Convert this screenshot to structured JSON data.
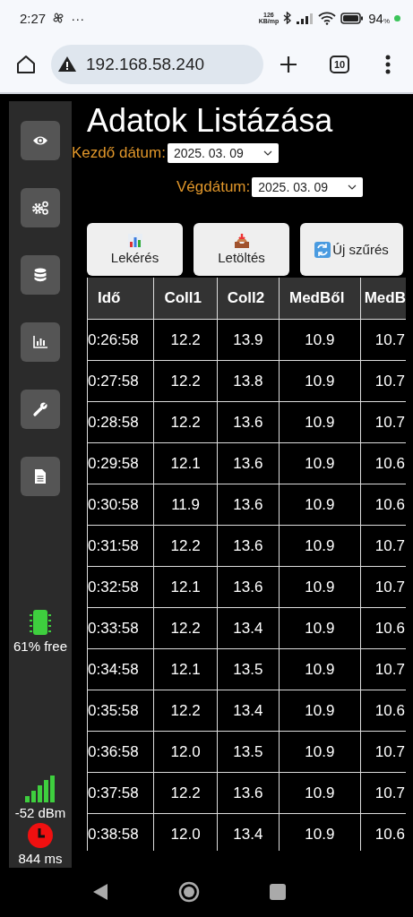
{
  "status_bar": {
    "time": "2:27",
    "more": "···",
    "speed_value": "126",
    "speed_unit": "KB/mp",
    "battery": "94",
    "battery_unit": "%"
  },
  "browser": {
    "url": "192.168.58.240",
    "tab_count": "10"
  },
  "sidebar": {
    "items": [
      {
        "kind": "eye"
      },
      {
        "kind": "gears"
      },
      {
        "kind": "database"
      },
      {
        "kind": "chart"
      },
      {
        "kind": "wrench"
      },
      {
        "kind": "document"
      }
    ],
    "memory": "61% free",
    "signal": "-52 dBm",
    "latency": "844 ms"
  },
  "page": {
    "title": "Adatok Listázása",
    "start_label": "Kezdő dátum:",
    "start_date": "2025. 03. 09",
    "end_label": "Végdátum:",
    "end_date": "2025. 03. 09"
  },
  "buttons": [
    {
      "kind": "chart",
      "label": "Lekérés"
    },
    {
      "kind": "download",
      "label": "Letöltés"
    },
    {
      "kind": "refresh",
      "label": "Új szűrés"
    }
  ],
  "table": {
    "columns": [
      "Idő",
      "Coll1",
      "Coll2",
      "MedBől",
      "MedB"
    ],
    "rows": [
      [
        "0:26:58",
        "12.2",
        "13.9",
        "10.9",
        "10.7"
      ],
      [
        "0:27:58",
        "12.2",
        "13.8",
        "10.9",
        "10.7"
      ],
      [
        "0:28:58",
        "12.2",
        "13.6",
        "10.9",
        "10.7"
      ],
      [
        "0:29:58",
        "12.1",
        "13.6",
        "10.9",
        "10.6"
      ],
      [
        "0:30:58",
        "11.9",
        "13.6",
        "10.9",
        "10.6"
      ],
      [
        "0:31:58",
        "12.2",
        "13.6",
        "10.9",
        "10.7"
      ],
      [
        "0:32:58",
        "12.1",
        "13.6",
        "10.9",
        "10.7"
      ],
      [
        "0:33:58",
        "12.2",
        "13.4",
        "10.9",
        "10.6"
      ],
      [
        "0:34:58",
        "12.1",
        "13.5",
        "10.9",
        "10.7"
      ],
      [
        "0:35:58",
        "12.2",
        "13.4",
        "10.9",
        "10.6"
      ],
      [
        "0:36:58",
        "12.0",
        "13.5",
        "10.9",
        "10.7"
      ],
      [
        "0:37:58",
        "12.2",
        "13.6",
        "10.9",
        "10.7"
      ],
      [
        "0:38:58",
        "12.0",
        "13.4",
        "10.9",
        "10.6"
      ]
    ]
  }
}
